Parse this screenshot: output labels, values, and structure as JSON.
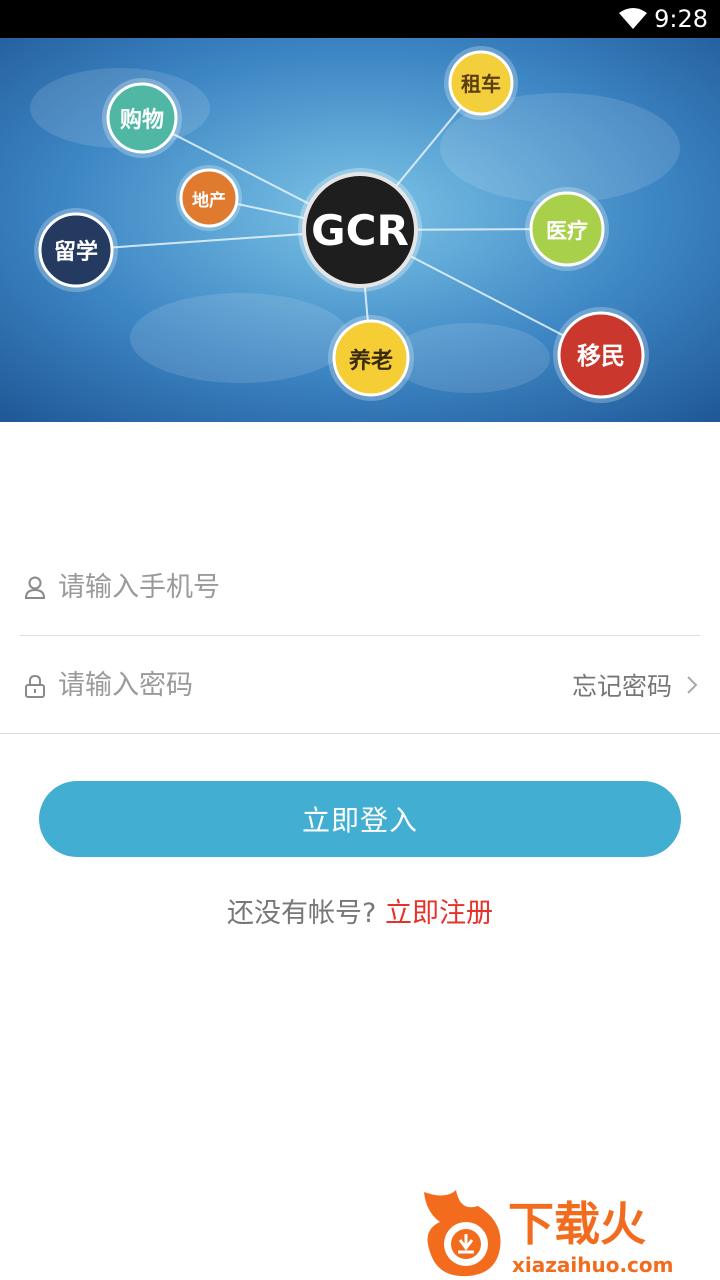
{
  "status_bar": {
    "time": "9:28",
    "wifi_icon": "wifi-icon"
  },
  "banner": {
    "center_logo": "GCR",
    "nodes": [
      "购物",
      "地产",
      "留学",
      "租车",
      "医疗",
      "移民",
      "养老"
    ]
  },
  "form": {
    "phone": {
      "placeholder": "请输入手机号",
      "icon": "user-icon"
    },
    "password": {
      "placeholder": "请输入密码",
      "icon": "lock-icon"
    },
    "forgot_label": "忘记密码"
  },
  "login_button": "立即登入",
  "register": {
    "question": "还没有帐号?",
    "link": "立即注册"
  },
  "watermark": {
    "text": "下载火",
    "url": "xiazaihuo.com"
  },
  "colors": {
    "primary": "#42aed1",
    "link_red": "#e6332a",
    "placeholder": "#9a9a9a"
  }
}
